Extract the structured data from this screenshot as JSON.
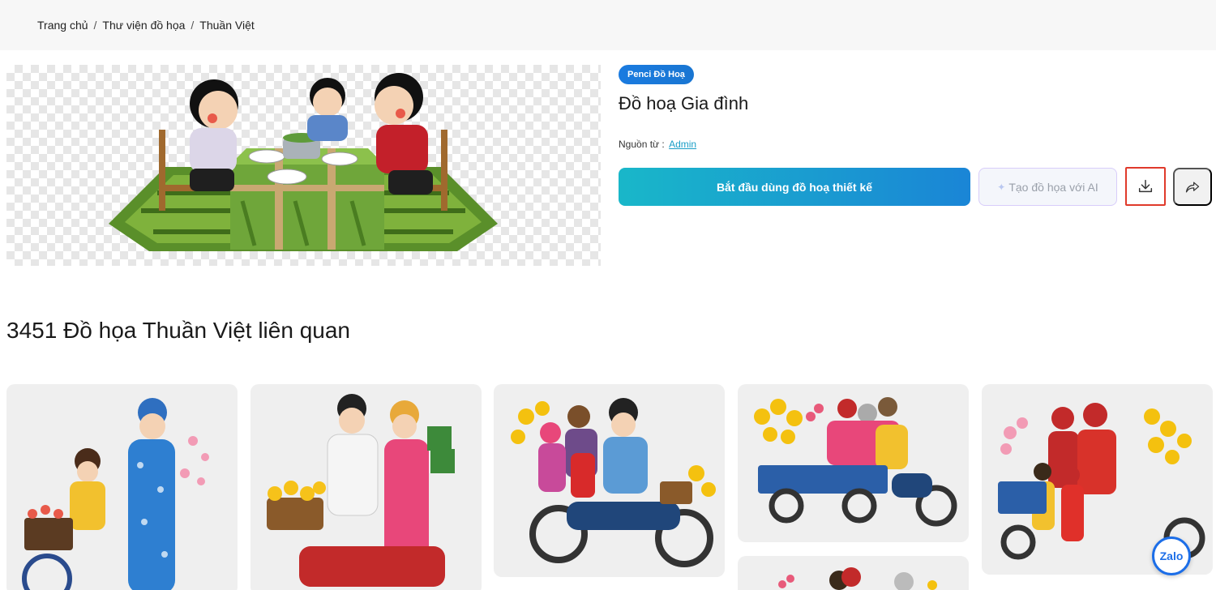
{
  "breadcrumb": {
    "items": [
      "Trang chủ",
      "Thư viện đồ họa",
      "Thuần Việt"
    ],
    "separator": "/"
  },
  "detail": {
    "badge": "Penci Đồ Hoạ",
    "title": "Đồ hoạ Gia đình",
    "source_label": "Nguồn từ :",
    "source_link": "Admin",
    "start_button": "Bắt đầu dùng đồ hoạ thiết kế",
    "ai_button": "Tạo đồ họa với AI",
    "download_icon": "download-icon",
    "share_icon": "share-icon"
  },
  "related": {
    "heading": "3451 Đồ họa Thuần Việt liên quan"
  },
  "chat": {
    "label": "Zalo"
  },
  "colors": {
    "accent_gradient_start": "#19b7c9",
    "accent_gradient_end": "#1a85d6",
    "badge_blue": "#1976d2",
    "highlight_red": "#e03a2b"
  }
}
